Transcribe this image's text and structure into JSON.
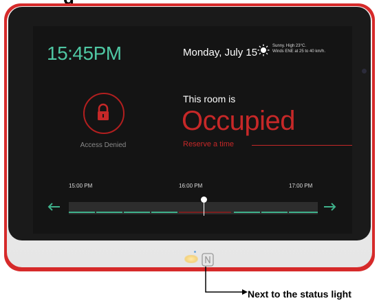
{
  "page": {
    "title_fragment": "g"
  },
  "screen": {
    "clock": "15:45PM",
    "date": "Monday, July 15",
    "weather": {
      "line1": "Sunny. High 23°C.",
      "line2": "Winds ENE at 25 to 40 km/h.",
      "icon": "sun-icon"
    },
    "access": {
      "label": "Access Denied",
      "icon": "lock-icon"
    },
    "room_status": {
      "prefix": "This room is",
      "status": "Occupied",
      "reserve_link": "Reserve a time"
    },
    "timeline": {
      "ticks": [
        "15:00 PM",
        "16:00 PM",
        "17:00 PM"
      ],
      "prev_icon": "arrow-left-icon",
      "next_icon": "arrow-right-icon"
    }
  },
  "device": {
    "status_light_icon": "status-light",
    "nfc_icon": "nfc-icon"
  },
  "annotation": {
    "text": "Next to the status light"
  },
  "colors": {
    "accent_green": "#4fc7a3",
    "occupied_red": "#c62828",
    "device_red": "#d62a2a",
    "screen_bg": "#141414"
  }
}
